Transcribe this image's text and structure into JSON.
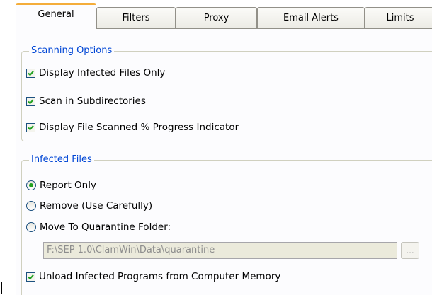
{
  "tabs": [
    {
      "label": "General",
      "active": true
    },
    {
      "label": "Filters",
      "active": false
    },
    {
      "label": "Proxy",
      "active": false
    },
    {
      "label": "Email Alerts",
      "active": false
    },
    {
      "label": "Limits",
      "active": false
    }
  ],
  "scanning_options": {
    "title": "Scanning Options",
    "options": [
      {
        "label": "Display Infected Files Only",
        "checked": true
      },
      {
        "label": "Scan in Subdirectories",
        "checked": true
      },
      {
        "label": "Display File Scanned % Progress Indicator",
        "checked": true
      }
    ]
  },
  "infected_files": {
    "title": "Infected Files",
    "actions": [
      {
        "label": "Report Only",
        "selected": true
      },
      {
        "label": "Remove (Use Carefully)",
        "selected": false
      },
      {
        "label": "Move To Quarantine Folder:",
        "selected": false
      }
    ],
    "quarantine_path": "F:\\SEP 1.0\\ClamWin\\Data\\quarantine",
    "browse_label": "...",
    "unload_option": {
      "label": "Unload Infected Programs from Computer Memory",
      "checked": true
    }
  },
  "colors": {
    "group_title": "#0046d5",
    "active_tab_accent": "#f4ad3a",
    "radio_dot": "#21a121",
    "checkmark": "#21a121"
  }
}
